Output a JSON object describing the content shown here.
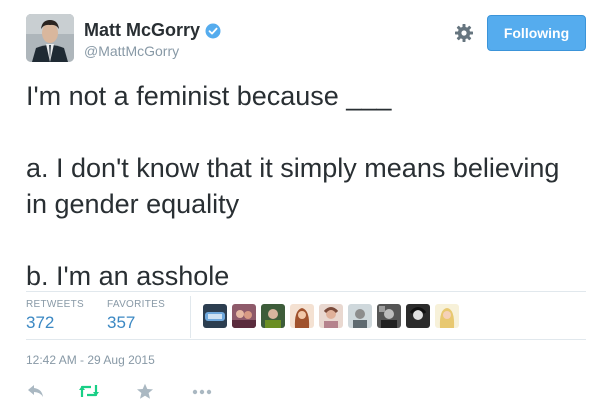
{
  "author": {
    "name": "Matt McGorry",
    "handle": "@MattMcGorry",
    "verified": true
  },
  "follow_button": {
    "label": "Following"
  },
  "tweet": {
    "text": "I'm not a feminist because ___\n\na. I don't know that it simply means believing in gender equality\n\nb. I'm an asshole"
  },
  "stats": {
    "retweets_label": "RETWEETS",
    "retweets_count": "372",
    "favorites_label": "FAVORITES",
    "favorites_count": "357"
  },
  "timestamp": "12:42 AM - 29 Aug 2015",
  "colors": {
    "accent": "#55acee",
    "text": "#292f33",
    "muted": "#8899a6",
    "retweet": "#19cf86"
  },
  "icons": {
    "settings": "gear-icon",
    "verified": "verified-badge-icon",
    "reply": "reply-icon",
    "retweet": "retweet-icon",
    "favorite": "star-icon",
    "more": "more-icon"
  }
}
